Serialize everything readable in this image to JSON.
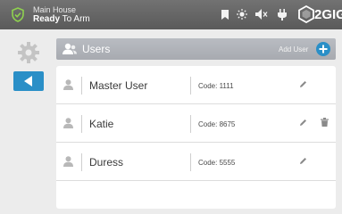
{
  "status": {
    "location": "Main House",
    "state_bold": "Ready",
    "state_rest": " To Arm",
    "brand": "2GIG"
  },
  "header": {
    "title": "Users",
    "add_label": "Add User"
  },
  "users": [
    {
      "name": "Master User",
      "code": "Code: 1111",
      "deletable": false
    },
    {
      "name": "Katie",
      "code": "Code: 8675",
      "deletable": true
    },
    {
      "name": "Duress",
      "code": "Code: 5555",
      "deletable": false
    }
  ],
  "colors": {
    "accent": "#2a8fc7",
    "statusbar": "#666666",
    "header": "#b0b3b9"
  },
  "icons": [
    "shield-check-icon",
    "bookmark-icon",
    "sun-icon",
    "speaker-muted-icon",
    "plug-icon",
    "2gig-logo-icon",
    "gear-icon",
    "back-arrow-icon",
    "users-icon",
    "plus-icon",
    "person-icon",
    "pencil-icon",
    "trash-icon"
  ]
}
